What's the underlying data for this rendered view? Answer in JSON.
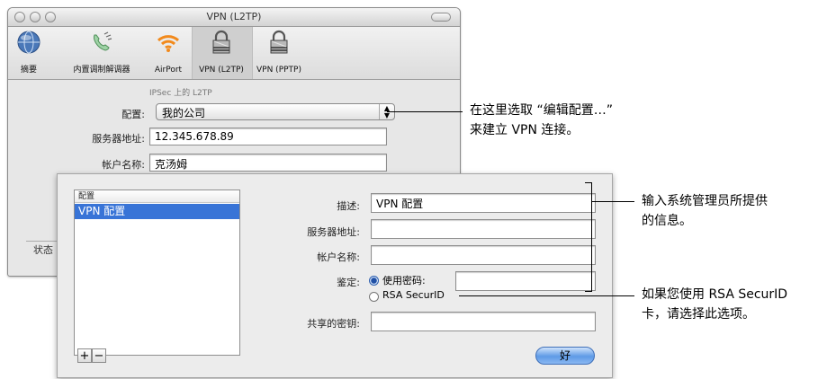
{
  "window": {
    "title": "VPN (L2TP)"
  },
  "toolbar": {
    "items": [
      {
        "label": "摘要",
        "icon": "globe-icon"
      },
      {
        "label": "内置调制解调器",
        "icon": "phone-icon"
      },
      {
        "label": "AirPort",
        "icon": "wifi-icon"
      },
      {
        "label": "VPN (L2TP)",
        "icon": "lock-icon"
      },
      {
        "label": "VPN (PPTP)",
        "icon": "lock-icon"
      }
    ]
  },
  "main": {
    "section_title": "IPSec 上的 L2TP",
    "config_label": "配置:",
    "config_value": "我的公司",
    "server_label": "服务器地址:",
    "server_value": "12.345.678.89",
    "account_label": "帐户名称:",
    "account_value": "克汤姆",
    "status_label": "状态"
  },
  "sheet": {
    "list_header": "配置",
    "list_items": [
      "VPN 配置"
    ],
    "add_label": "+",
    "remove_label": "−",
    "desc_label": "描述:",
    "desc_value": "VPN 配置",
    "server_label": "服务器地址:",
    "server_value": "",
    "account_label": "帐户名称:",
    "account_value": "",
    "auth_label": "鉴定:",
    "auth_password_label": "使用密码:",
    "auth_rsa_label": "RSA SecurID",
    "password_value": "",
    "shared_secret_label": "共享的密钥:",
    "shared_secret_value": "",
    "ok_label": "好"
  },
  "callouts": {
    "config": [
      "在这里选取 “编辑配置…”",
      "来建立 VPN 连接。"
    ],
    "admin": [
      "输入系统管理员所提供",
      "的信息。"
    ],
    "rsa": [
      "如果您使用 RSA SecurID",
      "卡，请选择此选项。"
    ]
  },
  "colors": {
    "selection": "#3874d7",
    "ok_button": "#5e9ae6",
    "window_bg": "#e7e7e7"
  }
}
